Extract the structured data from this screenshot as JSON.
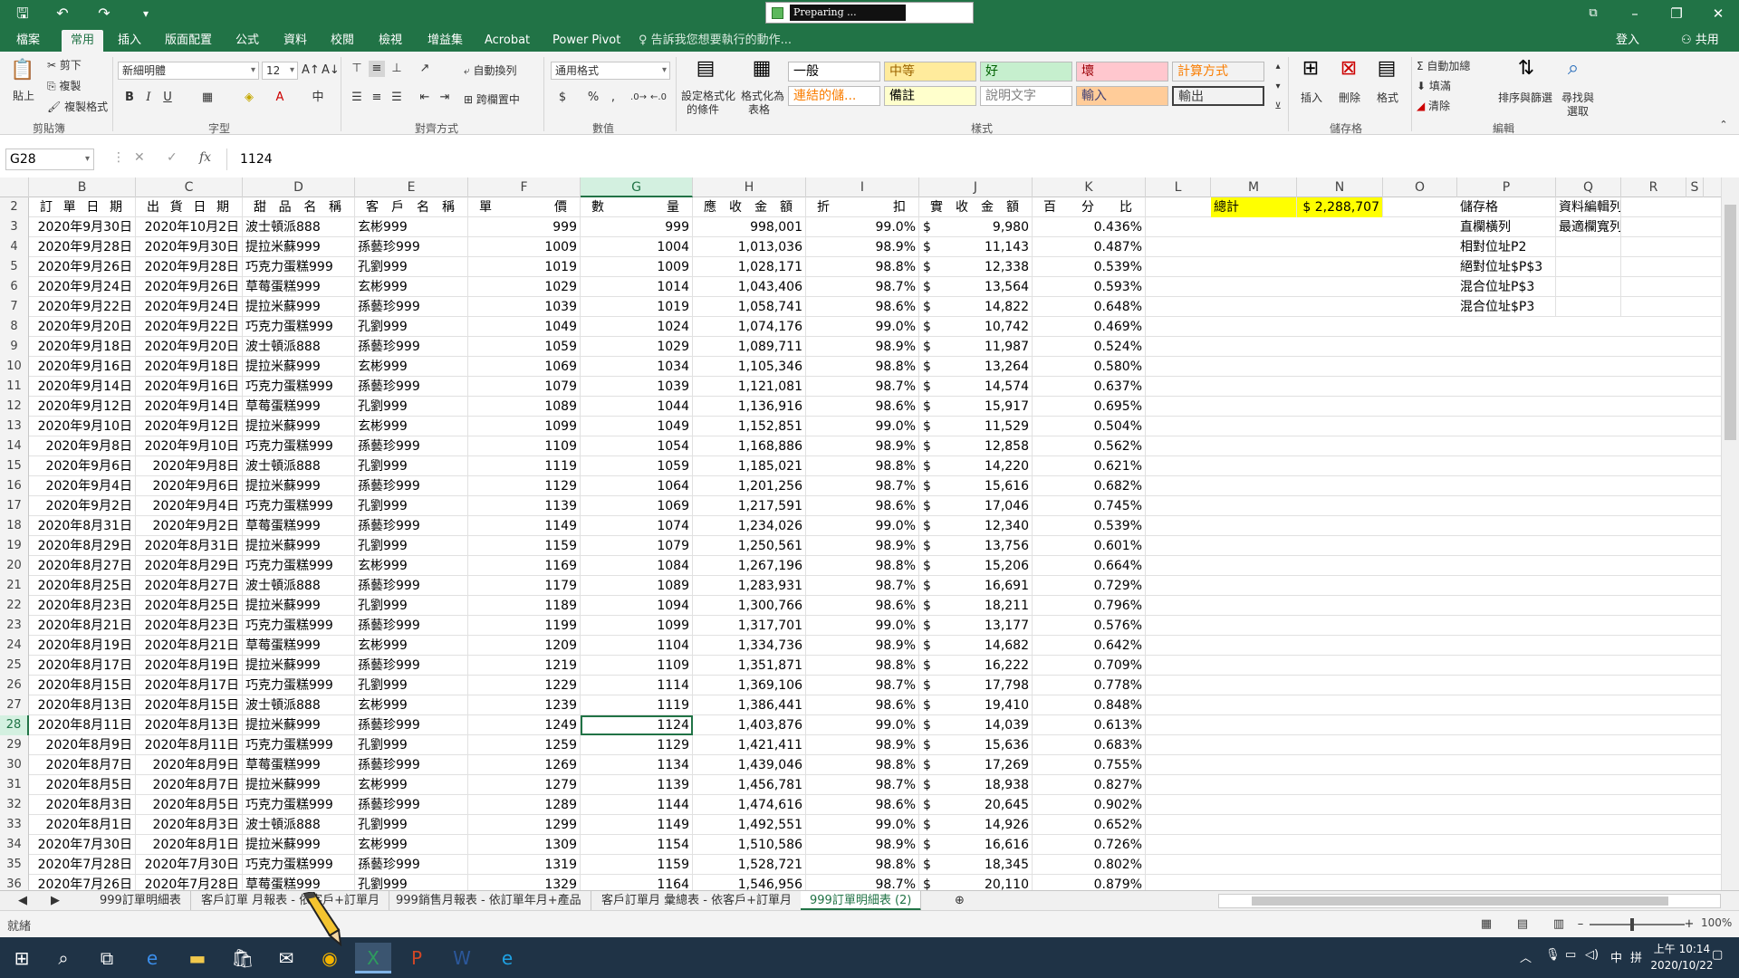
{
  "window": {
    "preparing_text": "Preparing ...",
    "restore_icon": "ribbon-display-icon"
  },
  "tabs": [
    "檔案",
    "常用",
    "插入",
    "版面配置",
    "公式",
    "資料",
    "校閱",
    "檢視",
    "增益集",
    "Acrobat",
    "Power Pivot"
  ],
  "active_tab": "常用",
  "tell_me": "告訴我您想要執行的動作...",
  "signin": "登入",
  "share": "共用",
  "ribbon": {
    "clipboard": {
      "paste": "貼上",
      "cut": "剪下",
      "copy": "複製",
      "format_painter": "複製格式",
      "label": "剪貼簿"
    },
    "font": {
      "name": "新細明體",
      "size": "12",
      "label": "字型"
    },
    "alignment": {
      "wrap": "自動換列",
      "merge": "跨欄置中",
      "label": "對齊方式"
    },
    "number": {
      "format": "通用格式",
      "label": "數值"
    },
    "styles": {
      "cond_format_1": "設定格式化",
      "cond_format_2": "的條件",
      "table_format_1": "格式化為",
      "table_format_2": "表格",
      "cells": [
        {
          "text": "一般",
          "bg": "#ffffff",
          "fg": "#000000"
        },
        {
          "text": "中等",
          "bg": "#ffeb9c",
          "fg": "#9c6500"
        },
        {
          "text": "好",
          "bg": "#c6efce",
          "fg": "#006100"
        },
        {
          "text": "壞",
          "bg": "#ffc7ce",
          "fg": "#9c0006"
        },
        {
          "text": "計算方式",
          "bg": "#f2f2f2",
          "fg": "#fa7d00"
        },
        {
          "text": "連結的儲...",
          "bg": "#ffffff",
          "fg": "#fa7d00"
        },
        {
          "text": "備註",
          "bg": "#ffffcc",
          "fg": "#000000"
        },
        {
          "text": "說明文字",
          "bg": "#ffffff",
          "fg": "#7f7f7f"
        },
        {
          "text": "輸入",
          "bg": "#ffcc99",
          "fg": "#3f3f76"
        },
        {
          "text": "輸出",
          "bg": "#f2f2f2",
          "fg": "#3f3f3f"
        }
      ],
      "label": "樣式"
    },
    "cells": {
      "insert": "插入",
      "delete": "刪除",
      "format": "格式",
      "label": "儲存格"
    },
    "editing": {
      "autosum": "自動加總",
      "fill": "填滿",
      "clear": "清除",
      "sort_filter_1": "排序與篩選",
      "find_1": "尋找與",
      "find_2": "選取",
      "label": "編輯"
    }
  },
  "formula_bar": {
    "name_box": "G28",
    "content": "1124"
  },
  "columns": [
    {
      "id": "B",
      "w": 118
    },
    {
      "id": "C",
      "w": 118
    },
    {
      "id": "D",
      "w": 124
    },
    {
      "id": "E",
      "w": 125
    },
    {
      "id": "F",
      "w": 124
    },
    {
      "id": "G",
      "w": 124
    },
    {
      "id": "H",
      "w": 125
    },
    {
      "id": "I",
      "w": 125
    },
    {
      "id": "J",
      "w": 125
    },
    {
      "id": "K",
      "w": 125
    },
    {
      "id": "L",
      "w": 72
    },
    {
      "id": "M",
      "w": 95
    },
    {
      "id": "N",
      "w": 95
    },
    {
      "id": "O",
      "w": 82
    },
    {
      "id": "P",
      "w": 109
    },
    {
      "id": "Q",
      "w": 72
    },
    {
      "id": "R",
      "w": 72
    },
    {
      "id": "S",
      "w": 19
    }
  ],
  "selected_column": "G",
  "selected_row": 28,
  "header_row": {
    "row": 2,
    "B": "訂單日期",
    "C": "出貨日期",
    "D": "甜品名稱",
    "E": "客戶名稱",
    "F": "單價",
    "G": "數量",
    "H": "應收金額",
    "I": "折扣",
    "J": "實收金額",
    "K": "百分比"
  },
  "summary": {
    "label": "總計",
    "value": "$ 2,288,707"
  },
  "side_notes": [
    {
      "row": 2,
      "P": "儲存格",
      "Q": "資料編輯列"
    },
    {
      "row": 3,
      "P": "直欄橫列",
      "Q": "最適欄寬列高"
    },
    {
      "row": 4,
      "P": "相對位址P2",
      "Q": ""
    },
    {
      "row": 5,
      "P": "絕對位址$P$3",
      "Q": ""
    },
    {
      "row": 6,
      "P": "混合位址P$3",
      "Q": ""
    },
    {
      "row": 7,
      "P": "混合位址$P3",
      "Q": ""
    }
  ],
  "rows": [
    {
      "n": 3,
      "order": "2020年9月30日",
      "ship": "2020年10月2日",
      "item": "波士頓派888",
      "cust": "玄彬999",
      "price": "999",
      "qty": "999",
      "recv": "998,001",
      "disc": "99.0%",
      "net": "9,980",
      "pct": "0.436%"
    },
    {
      "n": 4,
      "order": "2020年9月28日",
      "ship": "2020年9月30日",
      "item": "提拉米蘇999",
      "cust": "孫藝珍999",
      "price": "1009",
      "qty": "1004",
      "recv": "1,013,036",
      "disc": "98.9%",
      "net": "11,143",
      "pct": "0.487%"
    },
    {
      "n": 5,
      "order": "2020年9月26日",
      "ship": "2020年9月28日",
      "item": "巧克力蛋糕999",
      "cust": "孔劉999",
      "price": "1019",
      "qty": "1009",
      "recv": "1,028,171",
      "disc": "98.8%",
      "net": "12,338",
      "pct": "0.539%"
    },
    {
      "n": 6,
      "order": "2020年9月24日",
      "ship": "2020年9月26日",
      "item": "草莓蛋糕999",
      "cust": "玄彬999",
      "price": "1029",
      "qty": "1014",
      "recv": "1,043,406",
      "disc": "98.7%",
      "net": "13,564",
      "pct": "0.593%"
    },
    {
      "n": 7,
      "order": "2020年9月22日",
      "ship": "2020年9月24日",
      "item": "提拉米蘇999",
      "cust": "孫藝珍999",
      "price": "1039",
      "qty": "1019",
      "recv": "1,058,741",
      "disc": "98.6%",
      "net": "14,822",
      "pct": "0.648%"
    },
    {
      "n": 8,
      "order": "2020年9月20日",
      "ship": "2020年9月22日",
      "item": "巧克力蛋糕999",
      "cust": "孔劉999",
      "price": "1049",
      "qty": "1024",
      "recv": "1,074,176",
      "disc": "99.0%",
      "net": "10,742",
      "pct": "0.469%"
    },
    {
      "n": 9,
      "order": "2020年9月18日",
      "ship": "2020年9月20日",
      "item": "波士頓派888",
      "cust": "孫藝珍999",
      "price": "1059",
      "qty": "1029",
      "recv": "1,089,711",
      "disc": "98.9%",
      "net": "11,987",
      "pct": "0.524%"
    },
    {
      "n": 10,
      "order": "2020年9月16日",
      "ship": "2020年9月18日",
      "item": "提拉米蘇999",
      "cust": "玄彬999",
      "price": "1069",
      "qty": "1034",
      "recv": "1,105,346",
      "disc": "98.8%",
      "net": "13,264",
      "pct": "0.580%"
    },
    {
      "n": 11,
      "order": "2020年9月14日",
      "ship": "2020年9月16日",
      "item": "巧克力蛋糕999",
      "cust": "孫藝珍999",
      "price": "1079",
      "qty": "1039",
      "recv": "1,121,081",
      "disc": "98.7%",
      "net": "14,574",
      "pct": "0.637%"
    },
    {
      "n": 12,
      "order": "2020年9月12日",
      "ship": "2020年9月14日",
      "item": "草莓蛋糕999",
      "cust": "孔劉999",
      "price": "1089",
      "qty": "1044",
      "recv": "1,136,916",
      "disc": "98.6%",
      "net": "15,917",
      "pct": "0.695%"
    },
    {
      "n": 13,
      "order": "2020年9月10日",
      "ship": "2020年9月12日",
      "item": "提拉米蘇999",
      "cust": "玄彬999",
      "price": "1099",
      "qty": "1049",
      "recv": "1,152,851",
      "disc": "99.0%",
      "net": "11,529",
      "pct": "0.504%"
    },
    {
      "n": 14,
      "order": "2020年9月8日",
      "ship": "2020年9月10日",
      "item": "巧克力蛋糕999",
      "cust": "孫藝珍999",
      "price": "1109",
      "qty": "1054",
      "recv": "1,168,886",
      "disc": "98.9%",
      "net": "12,858",
      "pct": "0.562%"
    },
    {
      "n": 15,
      "order": "2020年9月6日",
      "ship": "2020年9月8日",
      "item": "波士頓派888",
      "cust": "孔劉999",
      "price": "1119",
      "qty": "1059",
      "recv": "1,185,021",
      "disc": "98.8%",
      "net": "14,220",
      "pct": "0.621%"
    },
    {
      "n": 16,
      "order": "2020年9月4日",
      "ship": "2020年9月6日",
      "item": "提拉米蘇999",
      "cust": "孫藝珍999",
      "price": "1129",
      "qty": "1064",
      "recv": "1,201,256",
      "disc": "98.7%",
      "net": "15,616",
      "pct": "0.682%"
    },
    {
      "n": 17,
      "order": "2020年9月2日",
      "ship": "2020年9月4日",
      "item": "巧克力蛋糕999",
      "cust": "孔劉999",
      "price": "1139",
      "qty": "1069",
      "recv": "1,217,591",
      "disc": "98.6%",
      "net": "17,046",
      "pct": "0.745%"
    },
    {
      "n": 18,
      "order": "2020年8月31日",
      "ship": "2020年9月2日",
      "item": "草莓蛋糕999",
      "cust": "孫藝珍999",
      "price": "1149",
      "qty": "1074",
      "recv": "1,234,026",
      "disc": "99.0%",
      "net": "12,340",
      "pct": "0.539%"
    },
    {
      "n": 19,
      "order": "2020年8月29日",
      "ship": "2020年8月31日",
      "item": "提拉米蘇999",
      "cust": "孔劉999",
      "price": "1159",
      "qty": "1079",
      "recv": "1,250,561",
      "disc": "98.9%",
      "net": "13,756",
      "pct": "0.601%"
    },
    {
      "n": 20,
      "order": "2020年8月27日",
      "ship": "2020年8月29日",
      "item": "巧克力蛋糕999",
      "cust": "玄彬999",
      "price": "1169",
      "qty": "1084",
      "recv": "1,267,196",
      "disc": "98.8%",
      "net": "15,206",
      "pct": "0.664%"
    },
    {
      "n": 21,
      "order": "2020年8月25日",
      "ship": "2020年8月27日",
      "item": "波士頓派888",
      "cust": "孫藝珍999",
      "price": "1179",
      "qty": "1089",
      "recv": "1,283,931",
      "disc": "98.7%",
      "net": "16,691",
      "pct": "0.729%"
    },
    {
      "n": 22,
      "order": "2020年8月23日",
      "ship": "2020年8月25日",
      "item": "提拉米蘇999",
      "cust": "孔劉999",
      "price": "1189",
      "qty": "1094",
      "recv": "1,300,766",
      "disc": "98.6%",
      "net": "18,211",
      "pct": "0.796%"
    },
    {
      "n": 23,
      "order": "2020年8月21日",
      "ship": "2020年8月23日",
      "item": "巧克力蛋糕999",
      "cust": "孫藝珍999",
      "price": "1199",
      "qty": "1099",
      "recv": "1,317,701",
      "disc": "99.0%",
      "net": "13,177",
      "pct": "0.576%"
    },
    {
      "n": 24,
      "order": "2020年8月19日",
      "ship": "2020年8月21日",
      "item": "草莓蛋糕999",
      "cust": "玄彬999",
      "price": "1209",
      "qty": "1104",
      "recv": "1,334,736",
      "disc": "98.9%",
      "net": "14,682",
      "pct": "0.642%"
    },
    {
      "n": 25,
      "order": "2020年8月17日",
      "ship": "2020年8月19日",
      "item": "提拉米蘇999",
      "cust": "孫藝珍999",
      "price": "1219",
      "qty": "1109",
      "recv": "1,351,871",
      "disc": "98.8%",
      "net": "16,222",
      "pct": "0.709%"
    },
    {
      "n": 26,
      "order": "2020年8月15日",
      "ship": "2020年8月17日",
      "item": "巧克力蛋糕999",
      "cust": "孔劉999",
      "price": "1229",
      "qty": "1114",
      "recv": "1,369,106",
      "disc": "98.7%",
      "net": "17,798",
      "pct": "0.778%"
    },
    {
      "n": 27,
      "order": "2020年8月13日",
      "ship": "2020年8月15日",
      "item": "波士頓派888",
      "cust": "玄彬999",
      "price": "1239",
      "qty": "1119",
      "recv": "1,386,441",
      "disc": "98.6%",
      "net": "19,410",
      "pct": "0.848%"
    },
    {
      "n": 28,
      "order": "2020年8月11日",
      "ship": "2020年8月13日",
      "item": "提拉米蘇999",
      "cust": "孫藝珍999",
      "price": "1249",
      "qty": "1124",
      "recv": "1,403,876",
      "disc": "99.0%",
      "net": "14,039",
      "pct": "0.613%"
    },
    {
      "n": 29,
      "order": "2020年8月9日",
      "ship": "2020年8月11日",
      "item": "巧克力蛋糕999",
      "cust": "孔劉999",
      "price": "1259",
      "qty": "1129",
      "recv": "1,421,411",
      "disc": "98.9%",
      "net": "15,636",
      "pct": "0.683%"
    },
    {
      "n": 30,
      "order": "2020年8月7日",
      "ship": "2020年8月9日",
      "item": "草莓蛋糕999",
      "cust": "孫藝珍999",
      "price": "1269",
      "qty": "1134",
      "recv": "1,439,046",
      "disc": "98.8%",
      "net": "17,269",
      "pct": "0.755%"
    },
    {
      "n": 31,
      "order": "2020年8月5日",
      "ship": "2020年8月7日",
      "item": "提拉米蘇999",
      "cust": "玄彬999",
      "price": "1279",
      "qty": "1139",
      "recv": "1,456,781",
      "disc": "98.7%",
      "net": "18,938",
      "pct": "0.827%"
    },
    {
      "n": 32,
      "order": "2020年8月3日",
      "ship": "2020年8月5日",
      "item": "巧克力蛋糕999",
      "cust": "孫藝珍999",
      "price": "1289",
      "qty": "1144",
      "recv": "1,474,616",
      "disc": "98.6%",
      "net": "20,645",
      "pct": "0.902%"
    },
    {
      "n": 33,
      "order": "2020年8月1日",
      "ship": "2020年8月3日",
      "item": "波士頓派888",
      "cust": "孔劉999",
      "price": "1299",
      "qty": "1149",
      "recv": "1,492,551",
      "disc": "99.0%",
      "net": "14,926",
      "pct": "0.652%"
    },
    {
      "n": 34,
      "order": "2020年7月30日",
      "ship": "2020年8月1日",
      "item": "提拉米蘇999",
      "cust": "玄彬999",
      "price": "1309",
      "qty": "1154",
      "recv": "1,510,586",
      "disc": "98.9%",
      "net": "16,616",
      "pct": "0.726%"
    },
    {
      "n": 35,
      "order": "2020年7月28日",
      "ship": "2020年7月30日",
      "item": "巧克力蛋糕999",
      "cust": "孫藝珍999",
      "price": "1319",
      "qty": "1159",
      "recv": "1,528,721",
      "disc": "98.8%",
      "net": "18,345",
      "pct": "0.802%"
    },
    {
      "n": 36,
      "order": "2020年7月26日",
      "ship": "2020年7月28日",
      "item": "草莓蛋糕999",
      "cust": "孔劉999",
      "price": "1329",
      "qty": "1164",
      "recv": "1,546,956",
      "disc": "98.7%",
      "net": "20,110",
      "pct": "0.879%"
    }
  ],
  "currency_symbol": "$",
  "sheet_tabs": [
    "999訂單明細表",
    "客戶訂單 月報表 - 依客戶+訂單月",
    "999銷售月報表 - 依訂單年月+產品",
    "客戶訂單月 彙總表 - 依客戶+訂單月",
    "999訂單明細表 (2)"
  ],
  "active_sheet": "999訂單明細表 (2)",
  "status": {
    "ready": "就緒",
    "zoom": "100%"
  },
  "taskbar": {
    "time": "上午 10:14",
    "date": "2020/10/22",
    "ime": "中"
  }
}
